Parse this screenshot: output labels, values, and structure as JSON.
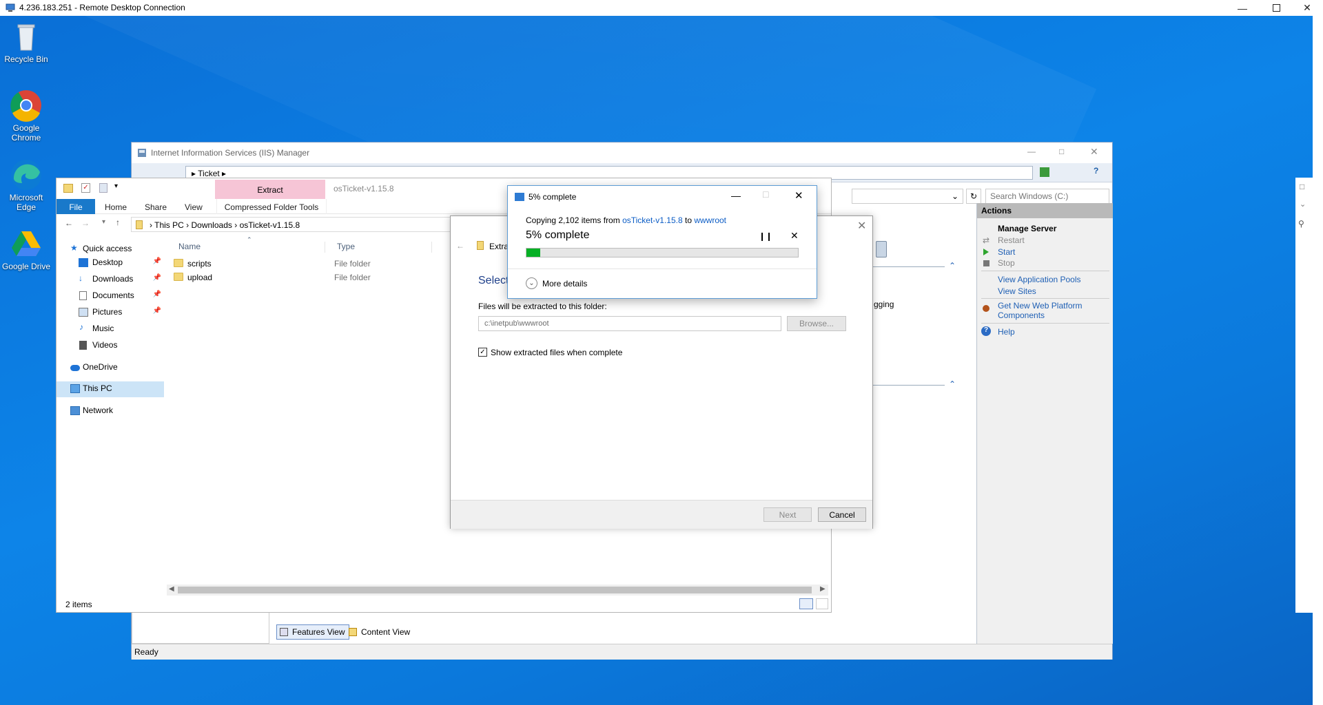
{
  "rdp": {
    "title": "4.236.183.251 - Remote Desktop Connection"
  },
  "desktop": {
    "icons": [
      {
        "label": "Recycle Bin",
        "icon": "recycle-bin-icon"
      },
      {
        "label": "Google Chrome",
        "icon": "chrome-icon"
      },
      {
        "label": "Microsoft Edge",
        "icon": "edge-icon"
      },
      {
        "label": "Google Drive",
        "icon": "google-drive-icon"
      }
    ]
  },
  "iis": {
    "title": "Internet Information Services (IIS) Manager",
    "address": "Ticket",
    "search_placeholder": "Search Windows (C:)",
    "partial_label": "gging",
    "status": "Ready",
    "view_tabs": {
      "features": "Features View",
      "content": "Content View"
    },
    "actions": {
      "header": "Actions",
      "manage_server": "Manage Server",
      "restart": "Restart",
      "start": "Start",
      "stop": "Stop",
      "view_app_pools": "View Application Pools",
      "view_sites": "View Sites",
      "get_components_1": "Get New Web Platform",
      "get_components_2": "Components",
      "help": "Help"
    }
  },
  "explorer": {
    "title": "osTicket-v1.15.8",
    "context_tab": "Extract",
    "ribbon_tabs": [
      "File",
      "Home",
      "Share",
      "View",
      "Compressed Folder Tools"
    ],
    "breadcrumb": [
      "This PC",
      "Downloads",
      "osTicket-v1.15.8"
    ],
    "columns": {
      "name": "Name",
      "type": "Type"
    },
    "files": [
      {
        "name": "scripts",
        "type": "File folder"
      },
      {
        "name": "upload",
        "type": "File folder"
      }
    ],
    "nav": {
      "quick_access": "Quick access",
      "desktop": "Desktop",
      "downloads": "Downloads",
      "documents": "Documents",
      "pictures": "Pictures",
      "music": "Music",
      "videos": "Videos",
      "onedrive": "OneDrive",
      "this_pc": "This PC",
      "network": "Network"
    },
    "status": "2 items"
  },
  "wizard": {
    "title_partial": "Extra",
    "heading_partial": "Select",
    "dest_label": "Files will be extracted to this folder:",
    "dest_value": "c:\\inetpub\\wwwroot",
    "browse": "Browse...",
    "show_files_label": "Show extracted files when complete",
    "show_files_checked": true,
    "next": "Next",
    "cancel": "Cancel"
  },
  "progress": {
    "title": "5% complete",
    "copying_prefix": "Copying 2,102 items from ",
    "source": "osTicket-v1.15.8",
    "to": " to ",
    "destination": "wwwroot",
    "percent_label": "5% complete",
    "percent": 5,
    "more_details": "More details"
  }
}
